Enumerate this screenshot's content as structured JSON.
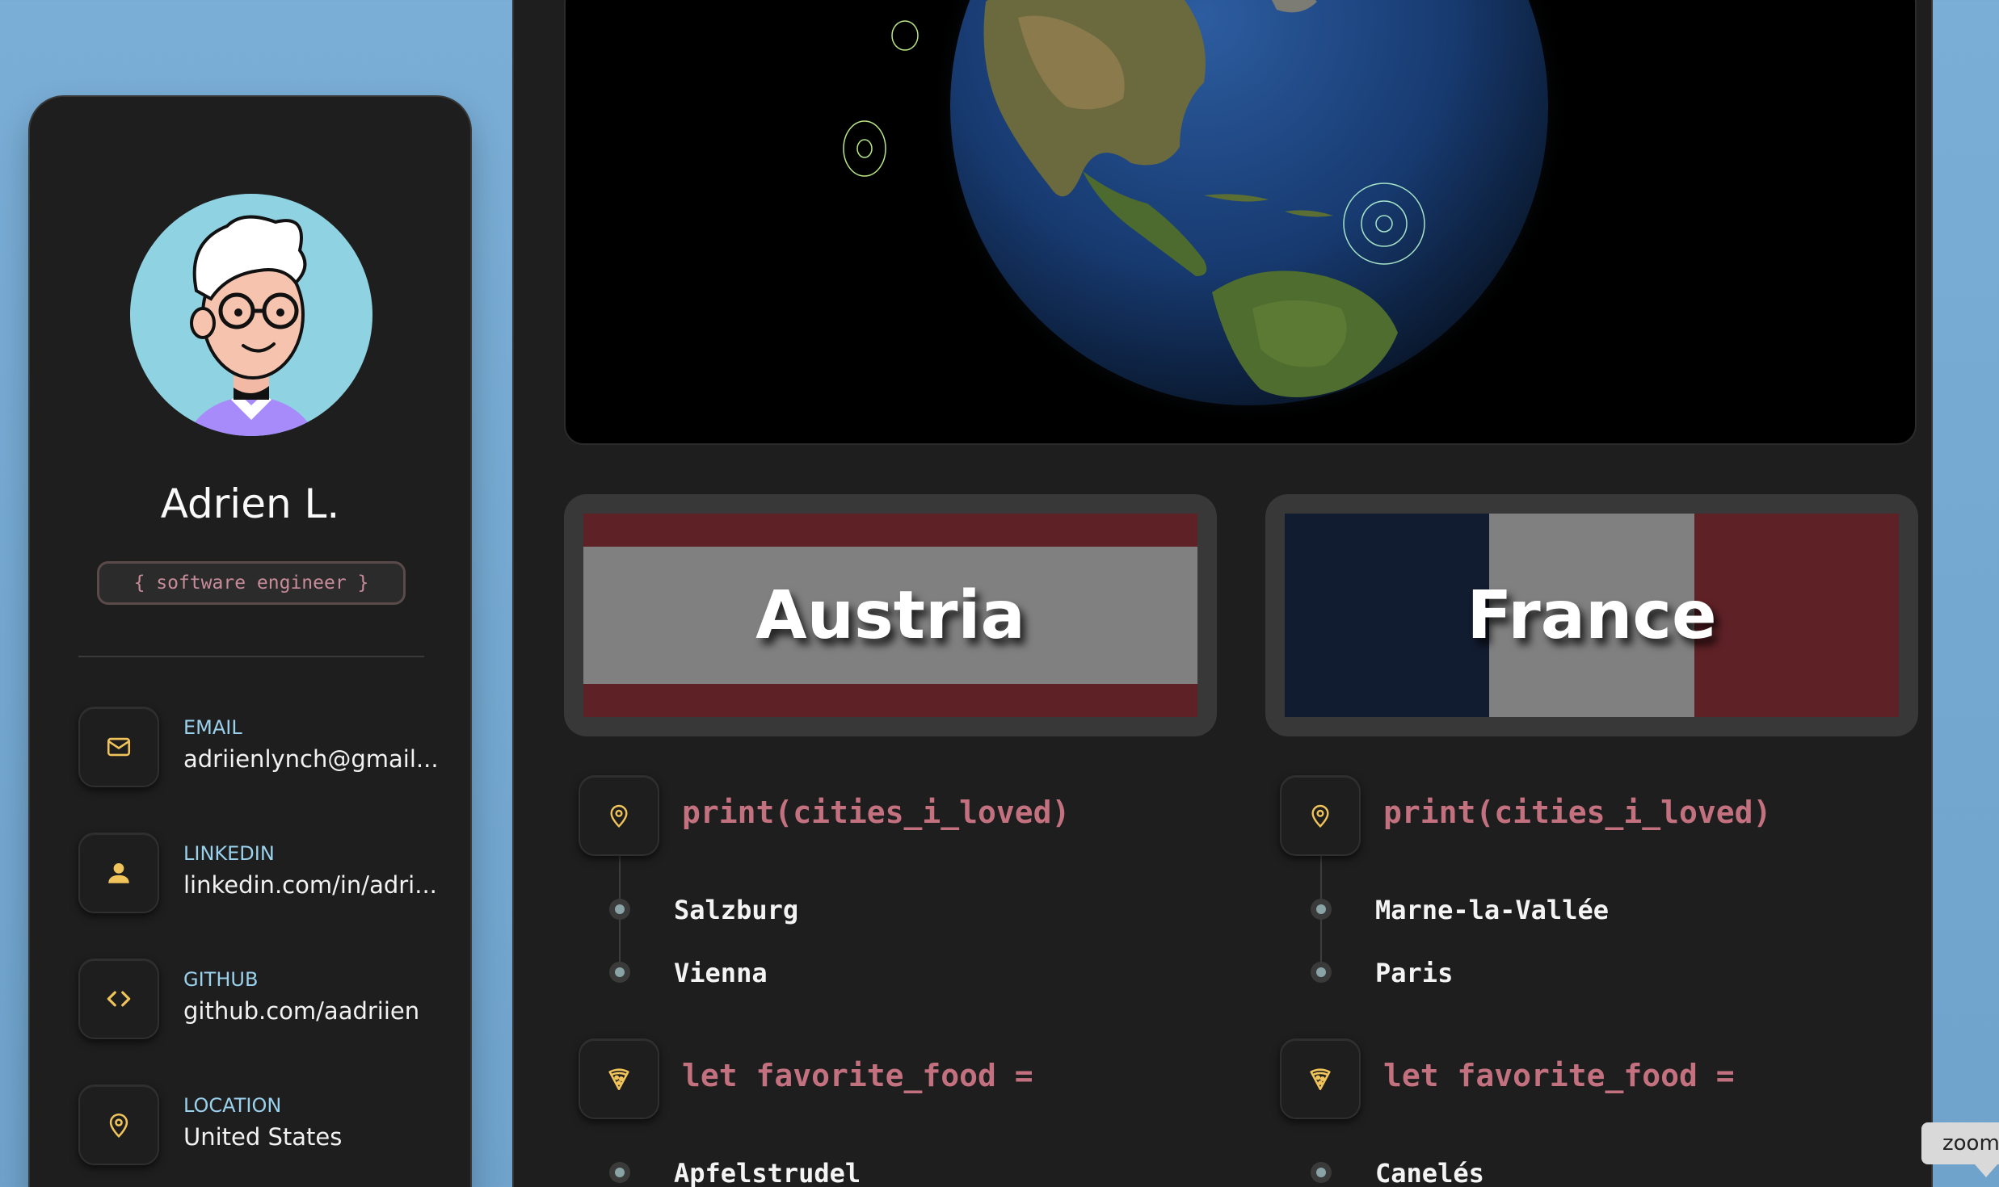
{
  "profile": {
    "name": "Adrien L.",
    "role": "{ software engineer }"
  },
  "contacts": [
    {
      "label": "EMAIL",
      "value": "adriienlynch@gmail...",
      "icon": "mail-icon"
    },
    {
      "label": "LINKEDIN",
      "value": "linkedin.com/in/adri...",
      "icon": "user-icon"
    },
    {
      "label": "GITHUB",
      "value": "github.com/aadriien",
      "icon": "code-icon"
    },
    {
      "label": "LOCATION",
      "value": "United States",
      "icon": "map-pin-icon"
    }
  ],
  "countries": [
    {
      "name": "Austria",
      "flag_colors": [
        "#5e2126",
        "#808080",
        "#5e2126"
      ],
      "cities_code": "print(cities_i_loved)",
      "cities": [
        "Salzburg",
        "Vienna"
      ],
      "food_code": "let favorite_food =",
      "foods": [
        "Apfelstrudel"
      ]
    },
    {
      "name": "France",
      "flag_colors": [
        "#121c30",
        "#808080",
        "#5e2126"
      ],
      "cities_code": "print(cities_i_loved)",
      "cities": [
        "Marne-la-Vallée",
        "Paris"
      ],
      "food_code": "let favorite_food =",
      "foods": [
        "Canelés"
      ]
    }
  ],
  "tooltip": "zoom",
  "colors": {
    "background": "#7aaed6",
    "card": "#1e1e1f",
    "accent_label": "#9ad1ec",
    "code_pink": "#c3707f",
    "icon_yellow": "#f0c45a"
  }
}
